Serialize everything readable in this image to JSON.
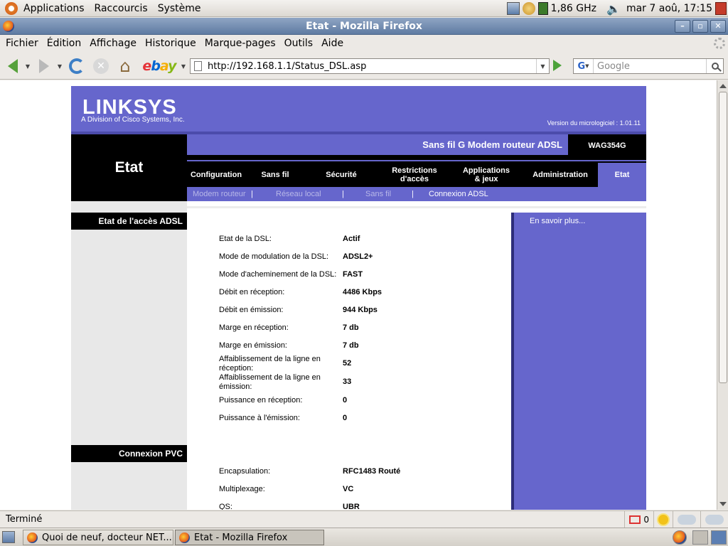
{
  "panel": {
    "menus": [
      "Applications",
      "Raccourcis",
      "Système"
    ],
    "cpu_freq": "1,86 GHz",
    "clock": "mar  7 aoû, 17:15"
  },
  "window": {
    "title": "Etat - Mozilla Firefox"
  },
  "browser": {
    "menu": [
      "Fichier",
      "Édition",
      "Affichage",
      "Historique",
      "Marque-pages",
      "Outils",
      "Aide"
    ],
    "url": "http://192.168.1.1/Status_DSL.asp",
    "search_placeholder": "Google",
    "ebay_label": "ebY",
    "status": "Terminé",
    "mail_count": "0"
  },
  "router": {
    "brand": "LINKSYS",
    "brand_sub": "A Division of Cisco Systems, Inc.",
    "firmware": "Version du micrologiciel : 1.01.11",
    "section": "Etat",
    "product": "Sans fil G Modem routeur ADSL",
    "model": "WAG354G",
    "tabs": [
      "Configuration",
      "Sans fil",
      "Sécurité",
      "Restrictions\nd'accès",
      "Applications\n& jeux",
      "Administration",
      "Etat"
    ],
    "subtabs": [
      "Modem routeur",
      "Réseau local",
      "Sans fil",
      "Connexion ADSL"
    ],
    "left_headings": [
      "Etat de l'accès ADSL",
      "Connexion PVC"
    ],
    "help_link": "En savoir plus...",
    "dsl_rows": [
      {
        "label": "Etat de la DSL:",
        "value": "Actif"
      },
      {
        "label": "Mode de modulation de la DSL:",
        "value": "ADSL2+"
      },
      {
        "label": "Mode d'acheminement de la DSL:",
        "value": "FAST"
      },
      {
        "label": "Débit en réception:",
        "value": "4486 Kbps"
      },
      {
        "label": "Débit en émission:",
        "value": "944 Kbps"
      },
      {
        "label": "Marge en réception:",
        "value": "7 db"
      },
      {
        "label": "Marge en émission:",
        "value": "7 db"
      },
      {
        "label": "Affaiblissement de la ligne en réception:",
        "value": "52"
      },
      {
        "label": "Affaiblissement de la ligne en émission:",
        "value": "33"
      },
      {
        "label": "Puissance en réception:",
        "value": "0"
      },
      {
        "label": "Puissance à l'émission:",
        "value": "0"
      }
    ],
    "pvc_rows": [
      {
        "label": "Encapsulation:",
        "value": "RFC1483 Routé"
      },
      {
        "label": "Multiplexage:",
        "value": "VC"
      },
      {
        "label": "QS:",
        "value": "UBR"
      }
    ]
  },
  "taskbar": {
    "tasks": [
      "Quoi de neuf, docteur NET...",
      "Etat - Mozilla Firefox"
    ]
  },
  "colors": {
    "linksys_purple": "#6666cc",
    "titlebar_blue": "#6b86ad"
  }
}
